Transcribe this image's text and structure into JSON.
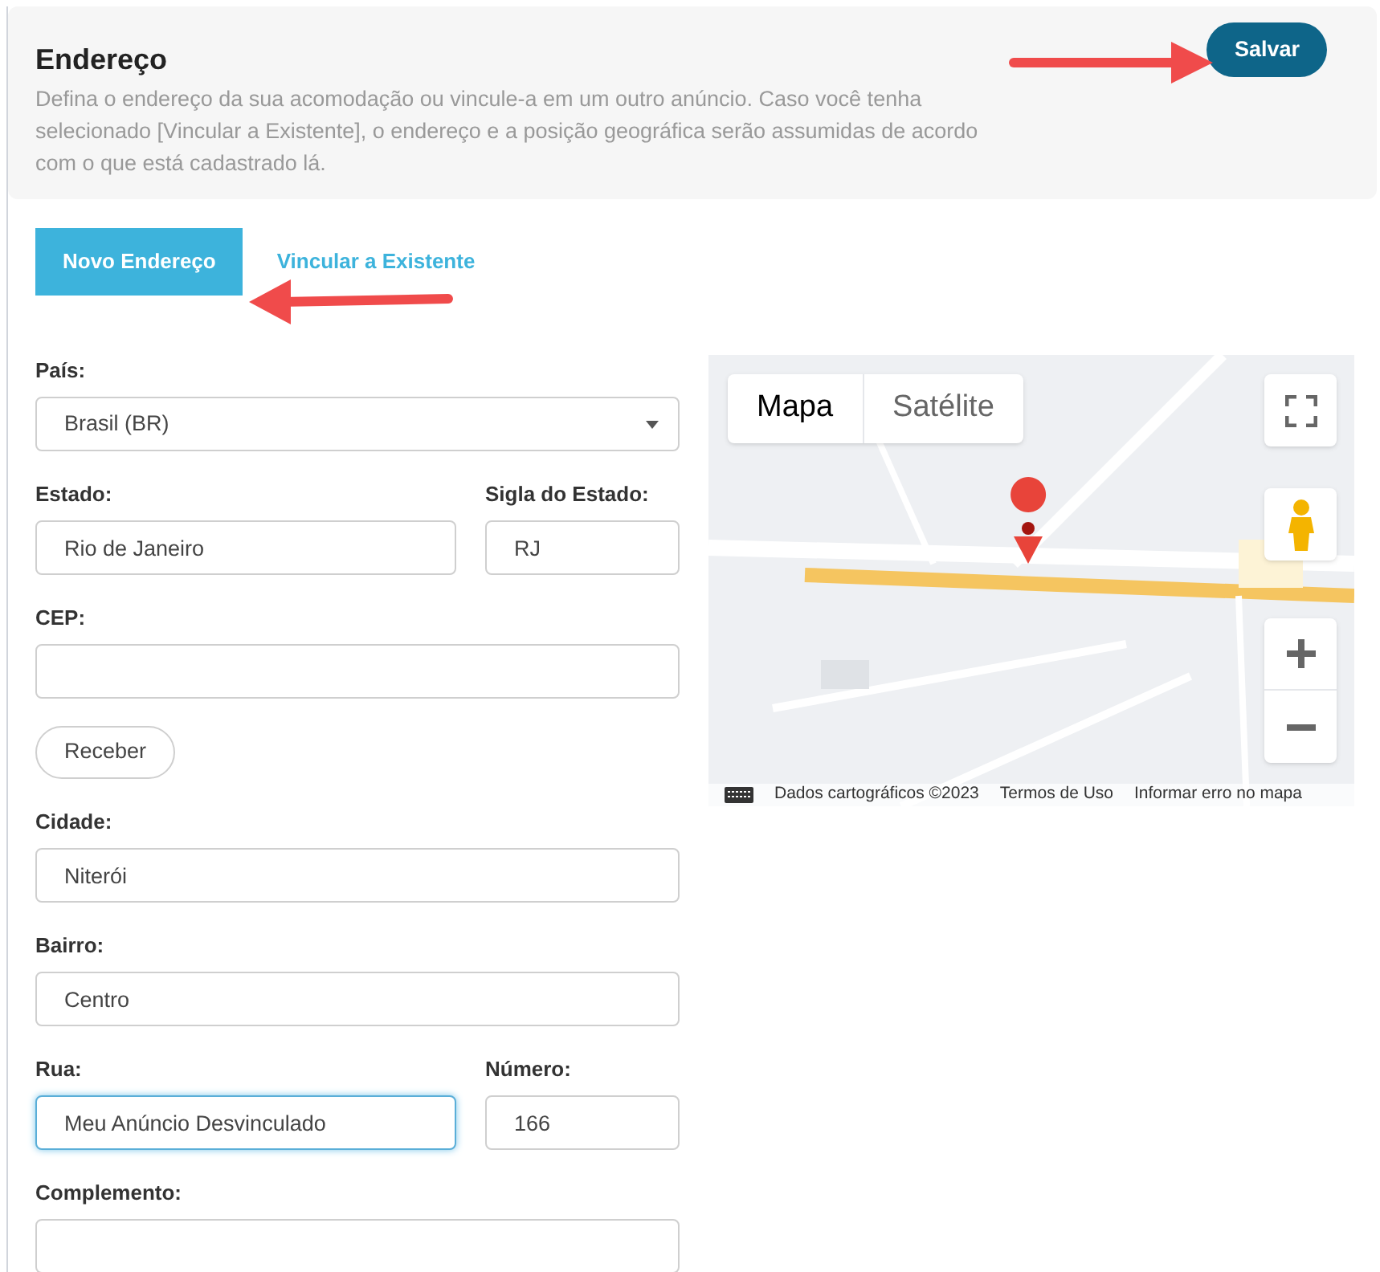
{
  "header": {
    "title": "Endereço",
    "description": "Defina o endereço da sua acomodação ou vincule-a em um outro anúncio. Caso você tenha selecionado [Vincular a Existente], o endereço e a posição geográfica serão assumidas de acordo com o que está cadastrado lá.",
    "save_button": "Salvar"
  },
  "tabs": [
    {
      "label": "Novo Endereço",
      "selected": true
    },
    {
      "label": "Vincular a Existente",
      "selected": false
    }
  ],
  "form_rows": [
    [
      {
        "kind": "select",
        "label": "País:",
        "value": "Brasil (BR)",
        "focused": false
      }
    ],
    [
      {
        "kind": "text",
        "label": "Estado:",
        "value": "Rio de Janeiro",
        "focused": false
      },
      {
        "kind": "text",
        "label": "Sigla do Estado:",
        "value": "RJ",
        "focused": false
      }
    ],
    [
      {
        "kind": "text",
        "label": "CEP:",
        "focused": false
      }
    ],
    [
      {
        "kind": "button",
        "value": "Receber",
        "focused": false
      }
    ],
    [
      {
        "kind": "text",
        "label": "Cidade:",
        "value": "Niterói",
        "focused": false
      }
    ],
    [
      {
        "kind": "text",
        "label": "Bairro:",
        "value": "Centro",
        "focused": false
      }
    ],
    [
      {
        "kind": "text",
        "label": "Rua:",
        "value": "Meu Anúncio Desvinculado",
        "focused": true
      },
      {
        "kind": "text",
        "label": "Número:",
        "value": "166",
        "focused": false
      }
    ],
    [
      {
        "kind": "text",
        "label": "Complemento:",
        "focused": false
      }
    ]
  ],
  "map": {
    "kind": "picture",
    "map_types": [
      {
        "label": "Mapa",
        "selected": true
      },
      {
        "label": "Satélite",
        "selected": false
      }
    ],
    "footer": [
      "Dados cartográficos ©2023",
      "Termos de Uso",
      "Informar erro no mapa"
    ]
  }
}
